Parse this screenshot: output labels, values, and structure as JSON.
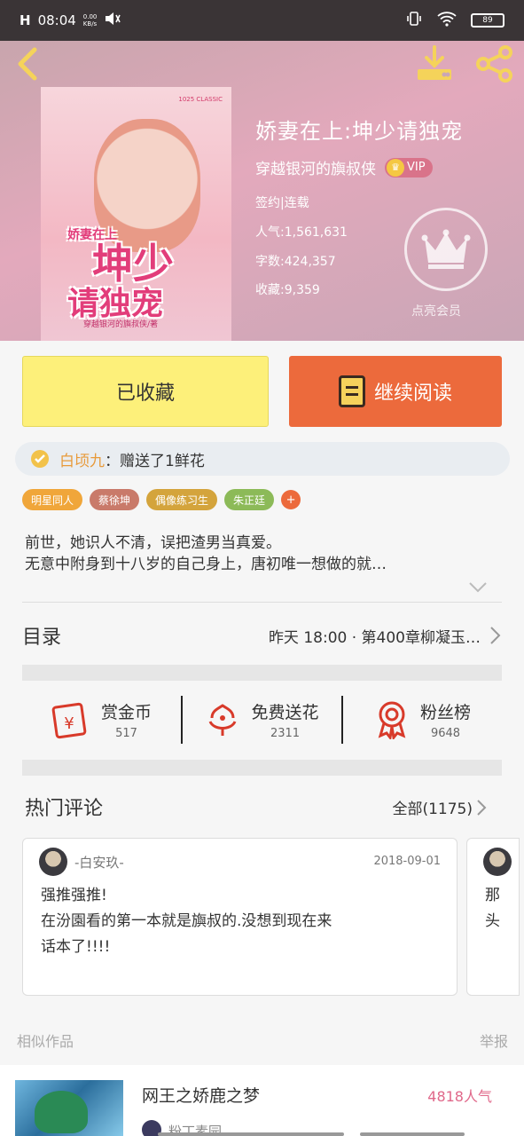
{
  "status_bar": {
    "signal": "H",
    "time": "08:04",
    "net_speed": "0.00\nKB/s",
    "battery": "89"
  },
  "book": {
    "title": "娇妻在上:坤少请独宠",
    "author": "穿越银河的旟叔侠",
    "vip_label": "VIP",
    "sign_status": "签约|连载",
    "popularity": "人气:1,561,631",
    "word_count": "字数:424,357",
    "favorites": "收藏:9,359",
    "member_label": "点亮会员",
    "cover": {
      "title_line1": "坤少",
      "title_line2": "请独宠",
      "small_title": "娇妻在上",
      "publisher": "1025 CLASSIC",
      "subtitle": "穿越银河的旟叔侠/著"
    }
  },
  "actions": {
    "favorite_label": "已收藏",
    "read_label": "继续阅读"
  },
  "gift": {
    "user": "白顷九",
    "message": "：赠送了1鲜花"
  },
  "tags": [
    {
      "label": "明星同人",
      "color": "#f0a63a"
    },
    {
      "label": "蔡徐坤",
      "color": "#c97a6a"
    },
    {
      "label": "偶像练习生",
      "color": "#d4a43c"
    },
    {
      "label": "朱正廷",
      "color": "#8cba58"
    }
  ],
  "tag_more": "+",
  "synopsis": {
    "line1": "前世，她识人不清，误把渣男当真爱。",
    "line2": "无意中附身到十八岁的自己身上，唐初唯一想做的就…"
  },
  "catalog": {
    "label": "目录",
    "latest": "昨天 18:00 · 第400章柳凝玉…"
  },
  "stats": [
    {
      "label": "赏金币",
      "value": "517"
    },
    {
      "label": "免费送花",
      "value": "2311"
    },
    {
      "label": "粉丝榜",
      "value": "9648"
    }
  ],
  "comments": {
    "title": "热门评论",
    "see_all": "全部(1175)",
    "items": [
      {
        "user": "-白安玖-",
        "date": "2018-09-01",
        "line1": "强推强推!",
        "line2": "在汾園看的第一本就是旟叔的.没想到现在来",
        "line3": "话本了!!!!"
      }
    ],
    "partial_line1": "那",
    "partial_line2": "头"
  },
  "similar": {
    "label": "相似作品",
    "report": "举报",
    "item": {
      "title": "网王之娇鹿之梦",
      "popularity": "4818人气",
      "author": "粉丁素园"
    }
  },
  "colors": {
    "accent_orange": "#ec6a3c",
    "favorite_yellow": "#fdf07a",
    "vip_gold": "#f5c842",
    "popularity_pink": "#e0688a"
  }
}
